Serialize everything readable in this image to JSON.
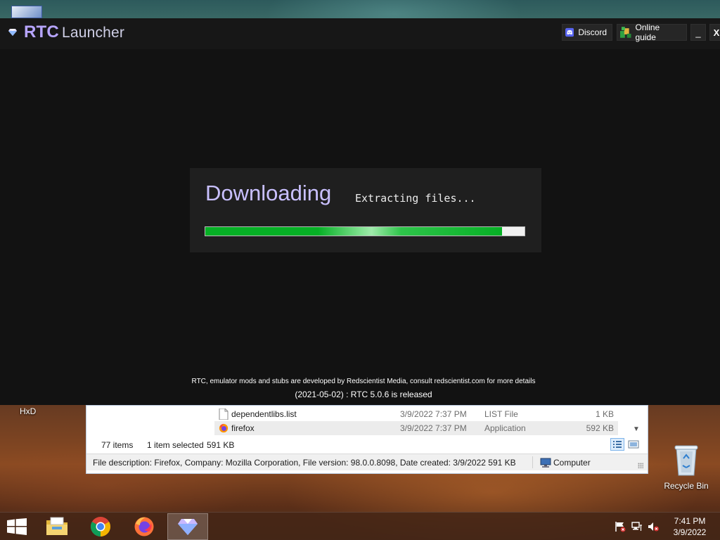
{
  "launcher": {
    "brand": "RTC",
    "title": "Launcher",
    "header_buttons": {
      "discord": "Discord",
      "online_guide": "Online guide",
      "minimize": "_",
      "close": "X"
    },
    "download": {
      "heading": "Downloading",
      "status": "Extracting files...",
      "progress": 0.93
    },
    "footer": {
      "credit": "RTC, emulator mods and stubs are developed by Redscientist Media, consult redscientist.com for more details",
      "news": "(2021-05-02) : RTC 5.0.6 is released"
    },
    "colors": {
      "accent": "#b7a5ff",
      "background": "#121212",
      "progress": "#06b025"
    }
  },
  "desktop": {
    "icons": [
      {
        "label": "HxD"
      },
      {
        "label": "Recycle Bin"
      }
    ]
  },
  "explorer": {
    "files": [
      {
        "name": "dependentlibs.list",
        "date": "3/9/2022 7:37 PM",
        "type": "LIST File",
        "size": "1 KB"
      },
      {
        "name": "firefox",
        "date": "3/9/2022 7:37 PM",
        "type": "Application",
        "size": "592 KB"
      }
    ],
    "status": {
      "item_count": "77 items",
      "selection": "1 item selected",
      "selection_size": "591 KB",
      "file_description": "File description: Firefox, Company: Mozilla Corporation, File version: 98.0.0.8098, Date created: 3/9/2022  591 KB",
      "location": "Computer"
    }
  },
  "taskbar": {
    "apps": [
      {
        "icon": "file-explorer-icon"
      },
      {
        "icon": "chrome-icon"
      },
      {
        "icon": "firefox-icon"
      },
      {
        "icon": "rtc-launcher-icon",
        "active": true
      }
    ],
    "clock": {
      "time": "7:41 PM",
      "date": "3/9/2022"
    }
  }
}
